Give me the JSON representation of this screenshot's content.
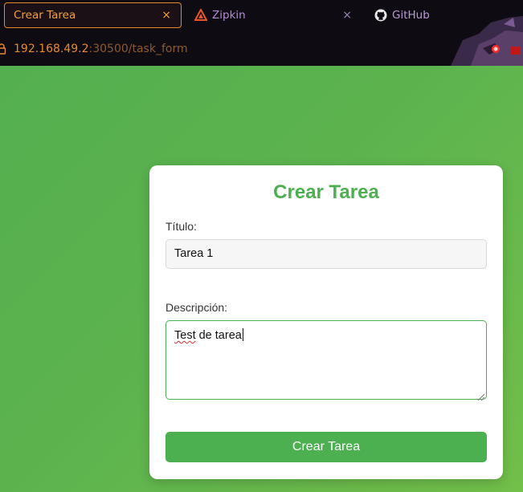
{
  "browser": {
    "tabs": [
      {
        "title": "Crear Tarea",
        "close": "×"
      },
      {
        "title": "Zipkin",
        "close": "×"
      },
      {
        "title": "GitHub"
      }
    ],
    "url": {
      "host": "192.168.49.2",
      "path": ":30500/task_form"
    },
    "colors": {
      "active_tab": "#f2a23a",
      "bg": "#0f0b12"
    }
  },
  "form": {
    "title": "Crear Tarea",
    "fields": {
      "titulo": {
        "label": "Título:",
        "value": "Tarea 1"
      },
      "descripcion": {
        "label": "Descripción:",
        "value_misspelled": "Test",
        "value_rest": " de tarea"
      }
    },
    "submit_label": "Crear Tarea",
    "colors": {
      "accent": "#4caf50",
      "background": "#5bb14e"
    }
  }
}
